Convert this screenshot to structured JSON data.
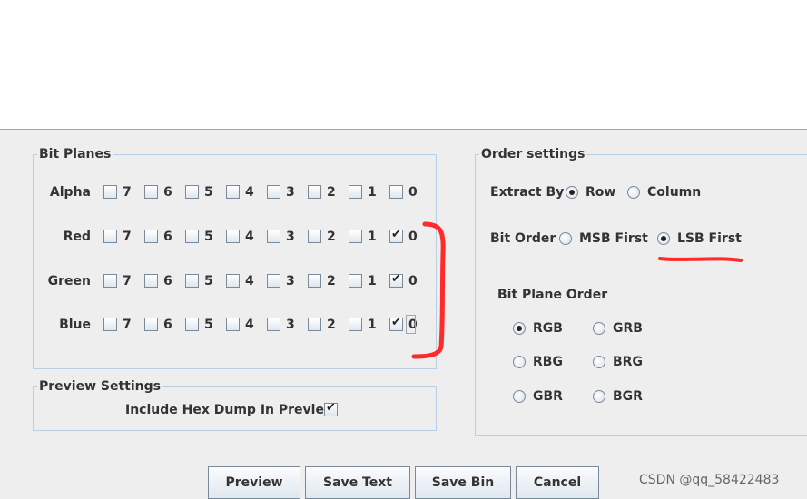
{
  "bit_planes": {
    "title": "Bit Planes",
    "bits": [
      "7",
      "6",
      "5",
      "4",
      "3",
      "2",
      "1",
      "0"
    ],
    "rows": [
      {
        "label": "Alpha",
        "checked": [
          false,
          false,
          false,
          false,
          false,
          false,
          false,
          false
        ]
      },
      {
        "label": "Red",
        "checked": [
          false,
          false,
          false,
          false,
          false,
          false,
          false,
          true
        ]
      },
      {
        "label": "Green",
        "checked": [
          false,
          false,
          false,
          false,
          false,
          false,
          false,
          true
        ]
      },
      {
        "label": "Blue",
        "checked": [
          false,
          false,
          false,
          false,
          false,
          false,
          false,
          true
        ]
      }
    ]
  },
  "preview_settings": {
    "title": "Preview Settings",
    "hex_dump_label": "Include Hex Dump In Preview",
    "hex_dump_checked": true
  },
  "order_settings": {
    "title": "Order settings",
    "extract_by": {
      "label": "Extract By",
      "options": [
        "Row",
        "Column"
      ],
      "selected": "Row"
    },
    "bit_order": {
      "label": "Bit Order",
      "options": [
        "MSB First",
        "LSB First"
      ],
      "selected": "LSB First"
    },
    "plane_order": {
      "label": "Bit Plane Order",
      "options": [
        "RGB",
        "GRB",
        "RBG",
        "BRG",
        "GBR",
        "BGR"
      ],
      "selected": "RGB"
    }
  },
  "buttons": {
    "preview": "Preview",
    "save_text": "Save Text",
    "save_bin": "Save Bin",
    "cancel": "Cancel"
  },
  "watermark": "CSDN @qq_58422483",
  "annotation_color": "#ff2a2a"
}
